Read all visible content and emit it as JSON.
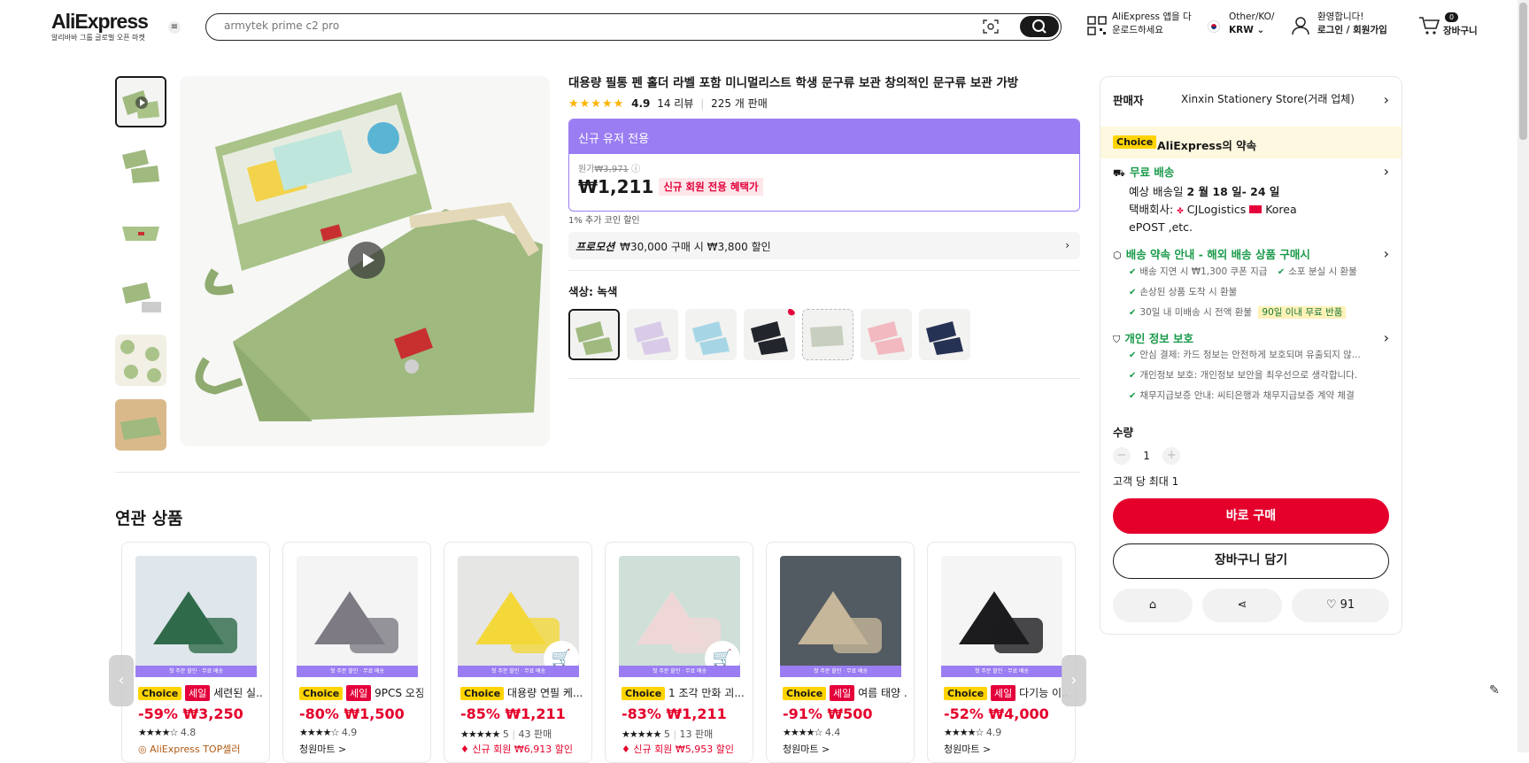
{
  "header": {
    "logo": "AliExpress",
    "logo_sub": "알리바바 그룹 글로벌 오픈 마켓",
    "search_placeholder": "armytek prime c2 pro",
    "app_line1": "AliExpress 앱을 다",
    "app_line2": "운로드하세요",
    "region_line1": "Other/KO/",
    "region_line2": "KRW",
    "account_line1": "환영합니다!",
    "account_line2": "로그인 / 회원가입",
    "cart_count": "0",
    "cart_label": "장바구니"
  },
  "product": {
    "title": "대용량 필통 펜 홀더 라벨 포함 미니멀리스트 학생 문구류 보관 창의적인 문구류 보관 가방",
    "stars": "★★★★★",
    "rating": "4.9",
    "reviews": "14 리뷰",
    "sold": "225 개 판매",
    "promo_banner": "신규 유저 전용",
    "orig_label": "원가",
    "orig_price": "₩3,971",
    "price": "₩1,211",
    "new_member_tag": "신규 회원 전용 혜택가",
    "coin": "1% 추가 코인 할인",
    "promo_label": "프로모션",
    "promo_text": "₩30,000 구매 시 ₩3,800 할인",
    "color_label": "색상: 녹색",
    "colors": [
      "#9bb07a",
      "#d9cbe8",
      "#a6d6e6",
      "#22252c",
      "#c8cfc0",
      "#f2b9c0",
      "#263253"
    ],
    "image_bg": "#f7f7f5",
    "pouch_green": "#9fb97f"
  },
  "panel": {
    "seller_label": "판매자",
    "seller_name": "Xinxin Stationery Store(거래 업체)",
    "choice_badge": "Choice",
    "promise": "AliExpress의 약속",
    "free_ship": "무료 배송",
    "eta_prefix": "예상 배송일",
    "eta": "2 월 18 일- 24 일",
    "carrier_label": "택배회사:",
    "carrier": "CJLogistics",
    "carrier2": "Korea",
    "carrier3": "ePOST ,etc.",
    "guarantee": "배송 약속 안내 - 해외 배송 상품 구매시",
    "g1": "배송 지연 시 ₩1,300 쿠폰 지급",
    "g2": "소포 분실 시 환불",
    "g3": "손상된 상품 도착 시 환불",
    "g4": "30일 내 미배송 시 전액 환불",
    "g4_badge": "90일 이내 무료 반품",
    "privacy": "개인 정보 보호",
    "p1": "안심 결제: 카드 정보는 안전하게 보호되며 유출되지 않...",
    "p2": "개인정보 보호: 개인정보 보안을 최우선으로 생각합니다.",
    "p3": "채무지급보증 안내: 씨티은행과 채무지급보증 계약 체결",
    "qty_label": "수량",
    "qty": "1",
    "limit": "고객 당 최대 1",
    "buy": "바로 구매",
    "add_cart": "장바구니 담기",
    "wish_count": "91"
  },
  "related": {
    "title": "연관 상품",
    "strip": "첫 주문 할인 · 무료 배송",
    "cards": [
      {
        "name": "세련된 실...",
        "sale": true,
        "price": "-59% ₩3,250",
        "stars": "★★★★☆",
        "rating": "4.8",
        "extra": "AliExpress TOP셀러",
        "sold": "",
        "img": "#dfe6ec",
        "obj": "#2f6b4a",
        "cart": false
      },
      {
        "name": "9PCS 오징...",
        "sale": true,
        "price": "-80% ₩1,500",
        "stars": "★★★★☆",
        "rating": "4.9",
        "extra": "청원마트 >",
        "sold": "",
        "img": "#f4f4f4",
        "obj": "#7d7a83",
        "cart": false
      },
      {
        "name": "대용량 연필 케...",
        "sale": false,
        "price": "-85% ₩1,211",
        "stars": "★★★★★",
        "rating": "5",
        "extra": "신규 회원 ₩6,913 할인",
        "sold": "43 판매",
        "img": "#e6e6e4",
        "obj": "#f4d83a",
        "cart": true
      },
      {
        "name": "1 조각 만화 괴...",
        "sale": false,
        "price": "-83% ₩1,211",
        "stars": "★★★★★",
        "rating": "5",
        "extra": "신규 회원 ₩5,953 할인",
        "sold": "13 판매",
        "img": "#cfe0d8",
        "obj": "#f0d7d7",
        "cart": true
      },
      {
        "name": "여름 태양 ...",
        "sale": true,
        "price": "-91% ₩500",
        "stars": "★★★★☆",
        "rating": "4.4",
        "extra": "청원마트 >",
        "sold": "",
        "img": "#525a62",
        "obj": "#c6b69a",
        "cart": false
      },
      {
        "name": "다기능 이...",
        "sale": true,
        "price": "-52% ₩4,000",
        "stars": "★★★★☆",
        "rating": "4.9",
        "extra": "청원마트 >",
        "sold": "",
        "img": "#f5f5f5",
        "obj": "#1c1c1e",
        "cart": false
      }
    ]
  }
}
